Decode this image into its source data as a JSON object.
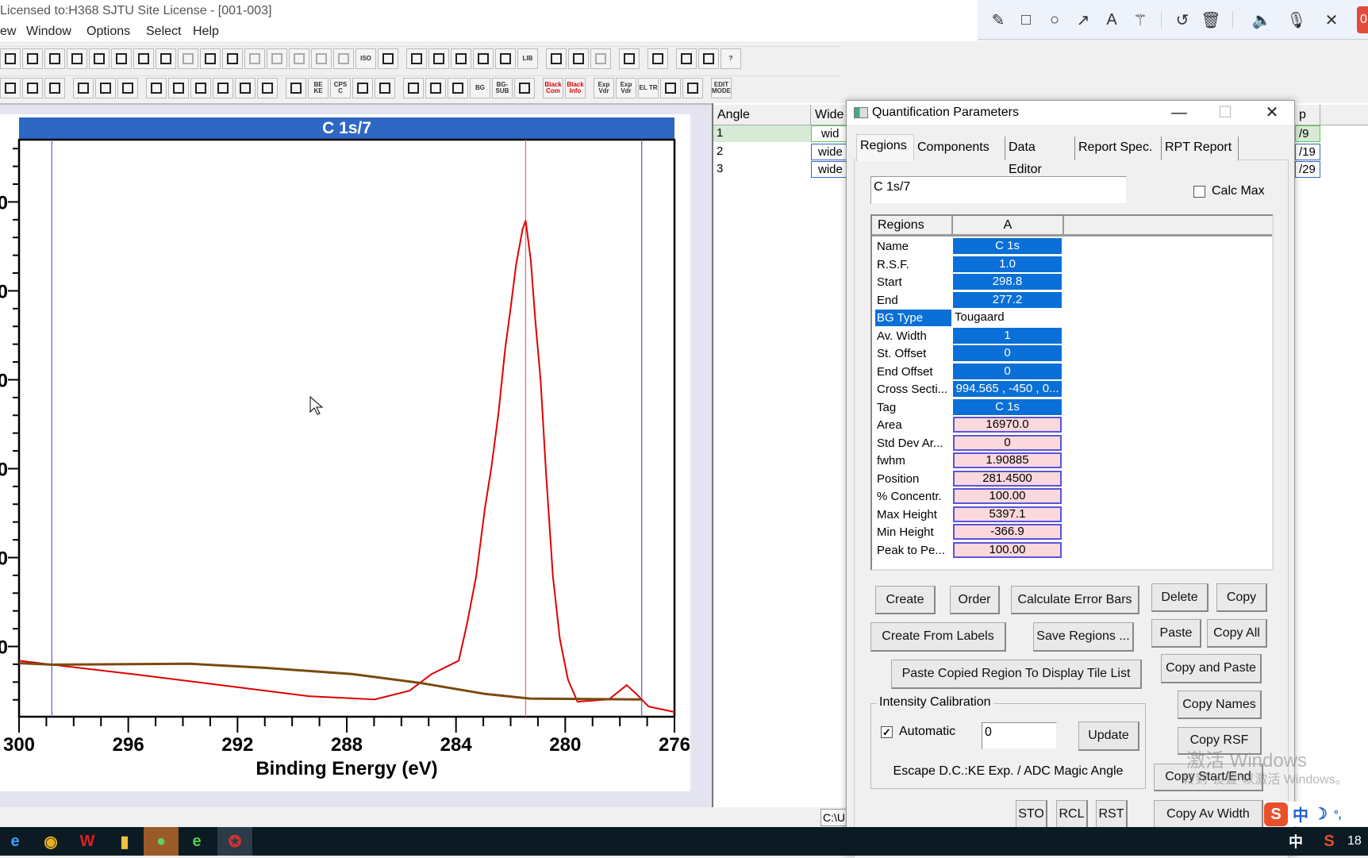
{
  "window": {
    "title": "Licensed to:H368 SJTU Site License - [001-003]"
  },
  "menu": [
    "ew",
    "Window",
    "Options",
    "Select",
    "Help"
  ],
  "annotation_toolbar": [
    "pencil-icon",
    "rectangle-icon",
    "circle-icon",
    "arrow-icon",
    "text-icon",
    "magic-wand-icon",
    "undo-icon",
    "trash-icon",
    "speaker-icon",
    "microphone-icon",
    "close-icon"
  ],
  "annotation_badge": "0",
  "toolbar1": [
    [
      "save-icon",
      "save-as-icon",
      "copy-icon",
      "copy-page-icon",
      "copy-tile-icon",
      "copy-display-icon",
      "copy-region-icon",
      "copy-color-icon",
      "copy-gray-icon",
      "copy-label-icon",
      "copy-block-icon",
      "gray-a-icon",
      "gray-b-icon",
      "gray-c-icon",
      "gray-d-icon",
      "gray-e-icon",
      "iso-icon",
      "clipboard-icon"
    ],
    [
      "rectangle-icon",
      "monitor-icon",
      "chart-window-icon",
      "arrow-right-icon",
      "pencil-icon",
      "lib-icon"
    ],
    [
      "compare-icon",
      "compare-vertical-icon",
      "compare-gray-icon"
    ],
    [
      "paste-icon"
    ],
    [
      "hand-icon"
    ],
    [
      "print-icon",
      "print-preview-icon",
      "help-icon"
    ]
  ],
  "toolbar2": [
    [
      "overlay-icon",
      "tile-icon",
      "grid-icon"
    ],
    [
      "right-bracket-icon",
      "left-bracket-icon",
      "collapse-icon"
    ],
    [
      "peak-up-icon",
      "peak-left-icon",
      "expand-horizontal-icon",
      "peak-arrow-icon",
      "chevrons-up-icon",
      "chevrons-down-icon"
    ],
    [
      "stamp-icon",
      "be-ke-icon",
      "cps-icon",
      "plus-marker-icon",
      "spectrum-icon"
    ],
    [
      "cyan-square-icon",
      "chart-icon",
      "wave-icon",
      "bg-icon",
      "bg-sub-icon",
      "n-peak-icon"
    ],
    [
      "black-com-icon",
      "black-info-icon"
    ],
    [
      "exp-vdr-icon",
      "exp-vdr2-icon",
      "el-tr-icon",
      "hv-icon",
      "question-icon"
    ],
    [
      "edit-mode-icon"
    ]
  ],
  "toolbar_icon_text": {
    "iso-icon": "ISO",
    "be-ke-icon": "BE KE",
    "cps-icon": "CPS C",
    "bg-icon": "BG",
    "bg-sub-icon": "BG- SUB",
    "black-com-icon": "Black Com",
    "black-info-icon": "Black Info",
    "exp-vdr-icon": "Exp Vdr",
    "exp-vdr2-icon": "Exp Vdr",
    "el-tr-icon": "EL TR",
    "edit-mode-icon": "EDIT MODE",
    "lib-icon": "LIB",
    "help-icon": "?"
  },
  "chart_data": {
    "type": "line",
    "title": "C 1s/7",
    "xlabel": "Binding Energy (eV)",
    "ylabel": "",
    "xlim": [
      300,
      276
    ],
    "x_reversed": true,
    "xticks": [
      300,
      296,
      292,
      288,
      284,
      280,
      276
    ],
    "ylim": [
      210,
      6700
    ],
    "yticks": [
      1000,
      2000,
      3000,
      4000,
      5000,
      6000
    ],
    "ytick_labels": [
      "0",
      "0",
      "0",
      "0",
      "0",
      "0"
    ],
    "grid": false,
    "region_markers": {
      "start": 298.8,
      "end": 277.2,
      "position": 281.45
    },
    "colors": {
      "spectrum": "#e00000",
      "background": "#7a4a10",
      "region": "#5a5ac8",
      "position": "#ff6060",
      "title_bar": "#2f67c4"
    },
    "series": [
      {
        "role": "spectrum",
        "x": [
          300,
          298.8,
          295.85,
          292.6,
          289.4,
          286.98,
          285.7,
          284.9,
          283.9,
          283.6,
          283.26,
          282.95,
          282.7,
          282.45,
          282.2,
          282.0,
          281.8,
          281.56,
          281.45,
          281.26,
          281.1,
          280.9,
          280.7,
          280.45,
          280.2,
          279.9,
          279.55,
          278.4,
          277.75,
          277.4,
          276.95,
          276.0
        ],
        "y": [
          840,
          796,
          689,
          565,
          441,
          405,
          503,
          689,
          840,
          1248,
          1789,
          2535,
          3023,
          3608,
          4345,
          4806,
          5294,
          5693,
          5791,
          5339,
          4682,
          3981,
          2943,
          1789,
          1088,
          627,
          379,
          405,
          565,
          467,
          325,
          263
        ]
      },
      {
        "role": "background",
        "x": [
          300,
          298.8,
          293.75,
          291.0,
          287.8,
          285.35,
          282.95,
          281.3,
          277.2
        ],
        "y": [
          813,
          796,
          805,
          760,
          689,
          592,
          467,
          414,
          405
        ]
      }
    ]
  },
  "list": {
    "headers": [
      "Angle",
      "Wide",
      "p"
    ],
    "rows": [
      {
        "angle": "1",
        "wide": "wid",
        "p": "/9"
      },
      {
        "angle": "2",
        "wide": "wide",
        "p": "/19"
      },
      {
        "angle": "3",
        "wide": "wide",
        "p": "/29"
      }
    ]
  },
  "dialog": {
    "title": "Quantification Parameters",
    "tabs": [
      "Regions",
      "Components",
      "Data Editor",
      "Report Spec.",
      "RPT Report"
    ],
    "active_tab": "Regions",
    "name_field": "C 1s/7",
    "calc_max_label": "Calc Max",
    "calc_max_checked": false,
    "grid_headers": [
      "Regions",
      "A"
    ],
    "grid_rows": [
      {
        "label": "Name",
        "value": "C 1s",
        "style": "blue"
      },
      {
        "label": "R.S.F.",
        "value": "1.0",
        "style": "blue"
      },
      {
        "label": "Start",
        "value": "298.8",
        "style": "blue"
      },
      {
        "label": "End",
        "value": "277.2",
        "style": "blue"
      },
      {
        "label": "BG Type",
        "value": "Tougaard",
        "style": "plain"
      },
      {
        "label": "Av. Width",
        "value": "1",
        "style": "blue"
      },
      {
        "label": "St. Offset",
        "value": "0",
        "style": "blue"
      },
      {
        "label": "End Offset",
        "value": "0",
        "style": "blue"
      },
      {
        "label": "Cross Secti...",
        "value": "994.565 , -450 , 0...",
        "style": "blue"
      },
      {
        "label": "Tag",
        "value": "C 1s",
        "style": "blue"
      },
      {
        "label": "Area",
        "value": "16970.0",
        "style": "pink"
      },
      {
        "label": "Std Dev Ar...",
        "value": "0",
        "style": "pink"
      },
      {
        "label": "fwhm",
        "value": "1.90885",
        "style": "pink"
      },
      {
        "label": "Position",
        "value": "281.4500",
        "style": "pink"
      },
      {
        "label": "% Concentr.",
        "value": "100.00",
        "style": "pink"
      },
      {
        "label": "Max Height",
        "value": "5397.1",
        "style": "pink"
      },
      {
        "label": "Min Height",
        "value": "-366.9",
        "style": "pink"
      },
      {
        "label": "Peak to Pe...",
        "value": "100.00",
        "style": "pink"
      }
    ],
    "buttons": {
      "create": "Create",
      "order": "Order",
      "calc_error": "Calculate Error Bars",
      "delete": "Delete",
      "copy": "Copy",
      "create_labels": "Create From Labels",
      "save_regions": "Save Regions ...",
      "paste": "Paste",
      "copy_all": "Copy All",
      "paste_copied": "Paste Copied Region To Display Tile List",
      "copy_paste": "Copy and Paste",
      "copy_names": "Copy Names",
      "copy_rsf": "Copy RSF",
      "copy_start_end": "Copy Start/End",
      "copy_av_width": "Copy Av Width",
      "sto": "STO",
      "rcl": "RCL",
      "rst": "RST",
      "update": "Update"
    },
    "intensity": {
      "label": "Intensity Calibration",
      "automatic_label": "Automatic",
      "automatic_checked": true,
      "value": "0",
      "escape_text": "Escape D.C.:KE Exp. / ADC Magic Angle"
    }
  },
  "status": {
    "path": "C:\\U"
  },
  "watermark": {
    "line1": "激活 Windows",
    "line2": "转到\"设置\"以激活 Windows。"
  },
  "ime": {
    "lang": "中"
  },
  "taskbar": {
    "apps": [
      "ie-icon",
      "chrome-icon",
      "wps-icon",
      "file-explorer-icon",
      "wechat-icon",
      "green-browser-icon",
      "casaxps-icon"
    ],
    "lang": "中",
    "clock": "18"
  }
}
